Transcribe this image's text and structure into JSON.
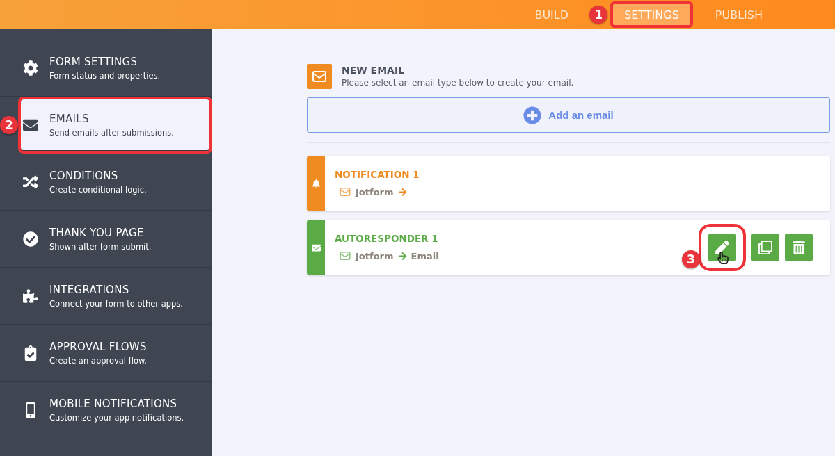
{
  "top_nav": {
    "tabs": [
      {
        "label": "BUILD",
        "selected": false
      },
      {
        "label": "SETTINGS",
        "selected": true,
        "annotation": "1"
      },
      {
        "label": "PUBLISH",
        "selected": false
      }
    ]
  },
  "sidebar": {
    "items": [
      {
        "title": "FORM SETTINGS",
        "subtitle": "Form status and properties.",
        "selected": false
      },
      {
        "title": "EMAILS",
        "subtitle": "Send emails after submissions.",
        "selected": true,
        "annotation": "2"
      },
      {
        "title": "CONDITIONS",
        "subtitle": "Create conditional logic.",
        "selected": false
      },
      {
        "title": "THANK YOU PAGE",
        "subtitle": "Shown after form submit.",
        "selected": false
      },
      {
        "title": "INTEGRATIONS",
        "subtitle": "Connect your form to other apps.",
        "selected": false
      },
      {
        "title": "APPROVAL FLOWS",
        "subtitle": "Create an approval flow.",
        "selected": false
      },
      {
        "title": "MOBILE NOTIFICATIONS",
        "subtitle": "Customize your app notifications.",
        "selected": false
      }
    ]
  },
  "new_email": {
    "title": "NEW EMAIL",
    "description": "Please select an email type below to create your email.",
    "add_button": "Add an email"
  },
  "emails": [
    {
      "kind": "notification",
      "color": "#f08b22",
      "title": "NOTIFICATION 1",
      "from": "Jotform"
    },
    {
      "kind": "autoresponder",
      "color": "#5aab46",
      "title": "AUTORESPONDER 1",
      "from": "Jotform",
      "to": "Email",
      "actions": [
        {
          "kind": "edit",
          "annotation": "3"
        },
        {
          "kind": "clone"
        },
        {
          "kind": "delete"
        }
      ]
    }
  ]
}
